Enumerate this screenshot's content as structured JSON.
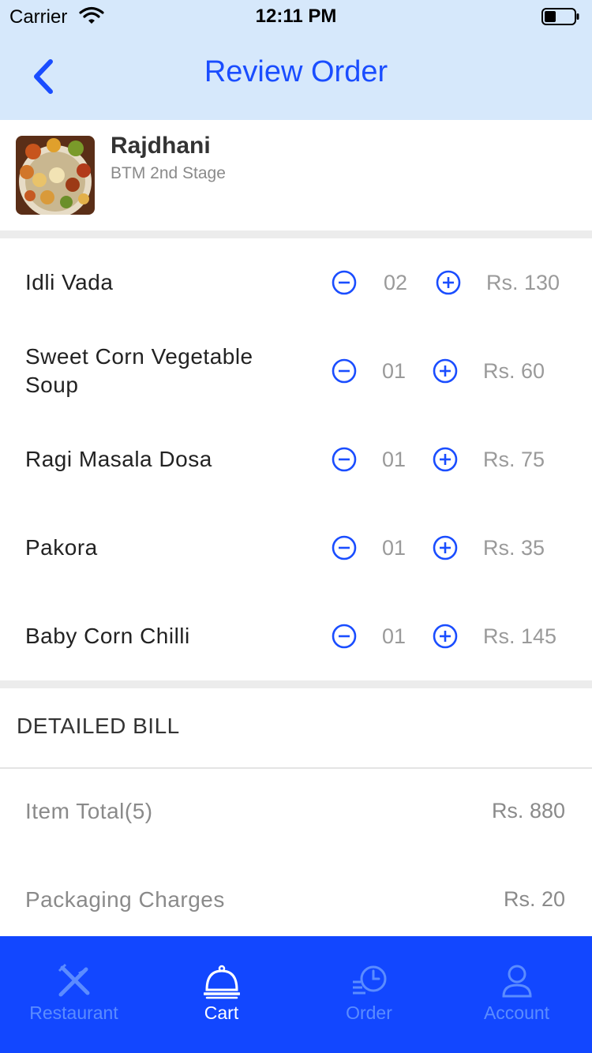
{
  "status_bar": {
    "carrier": "Carrier",
    "time": "12:11 PM"
  },
  "header": {
    "title": "Review Order",
    "back_icon": "chevron-left-icon"
  },
  "restaurant": {
    "name": "Rajdhani",
    "location": "BTM 2nd Stage"
  },
  "items": [
    {
      "name": "Idli Vada",
      "qty": "02",
      "price": "Rs. 130"
    },
    {
      "name": "Sweet Corn Vegetable Soup",
      "qty": "01",
      "price": "Rs. 60"
    },
    {
      "name": "Ragi Masala Dosa",
      "qty": "01",
      "price": "Rs. 75"
    },
    {
      "name": "Pakora",
      "qty": "01",
      "price": "Rs. 35"
    },
    {
      "name": "Baby Corn Chilli",
      "qty": "01",
      "price": "Rs. 145"
    }
  ],
  "bill": {
    "heading": "DETAILED BILL",
    "rows": [
      {
        "label": "Item Total(5)",
        "value": "Rs. 880"
      },
      {
        "label": "Packaging Charges",
        "value": "Rs. 20"
      }
    ]
  },
  "tabbar": {
    "tabs": [
      {
        "label": "Restaurant",
        "icon": "fork-knife-icon",
        "active": false
      },
      {
        "label": "Cart",
        "icon": "service-bell-icon",
        "active": true
      },
      {
        "label": "Order",
        "icon": "order-history-icon",
        "active": false
      },
      {
        "label": "Account",
        "icon": "user-icon",
        "active": false
      }
    ]
  },
  "colors": {
    "accent": "#1a4dff",
    "tabbar_bg": "#1247ff",
    "header_bg": "#d6e8fb",
    "muted_text": "#9a9a9a"
  }
}
